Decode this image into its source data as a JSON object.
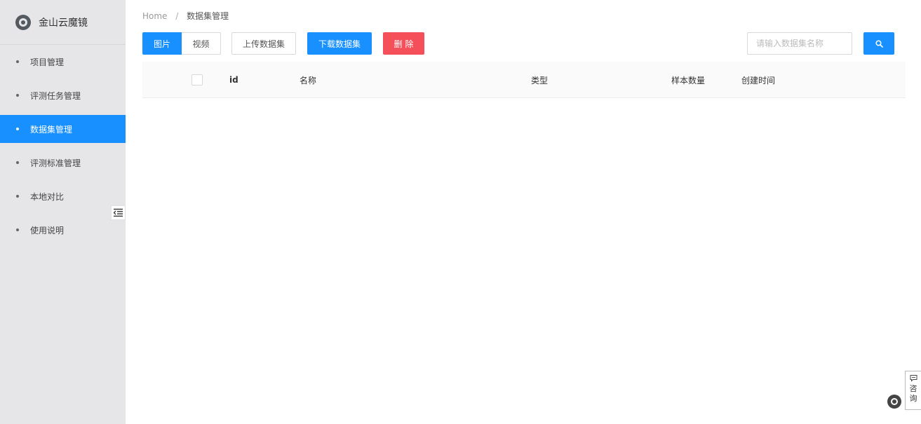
{
  "brand": {
    "title": "金山云魔镜"
  },
  "sidebar": {
    "items": [
      {
        "label": "项目管理",
        "active": false
      },
      {
        "label": "评测任务管理",
        "active": false
      },
      {
        "label": "数据集管理",
        "active": true
      },
      {
        "label": "评测标准管理",
        "active": false
      },
      {
        "label": "本地对比",
        "active": false
      },
      {
        "label": "使用说明",
        "active": false
      }
    ]
  },
  "breadcrumb": {
    "home": "Home",
    "separator": "/",
    "current": "数据集管理"
  },
  "toolbar": {
    "segment_image": "图片",
    "segment_video": "视频",
    "upload_label": "上传数据集",
    "download_label": "下载数据集",
    "delete_label": "删除"
  },
  "search": {
    "placeholder": "请输入数据集名称",
    "value": ""
  },
  "table": {
    "columns": [
      "id",
      "名称",
      "类型",
      "样本数量",
      "创建时间"
    ],
    "rows": []
  },
  "widgets": {
    "consult_label": "咨询"
  },
  "colors": {
    "primary": "#1890ff",
    "danger": "#f5505a",
    "sidebar_bg": "#e6e6e9"
  },
  "icons": {
    "brand": "brand-logo-icon",
    "collapse": "menu-fold-icon",
    "search": "search-icon",
    "chrome": "chrome-icon",
    "consult": "chat-icon"
  }
}
